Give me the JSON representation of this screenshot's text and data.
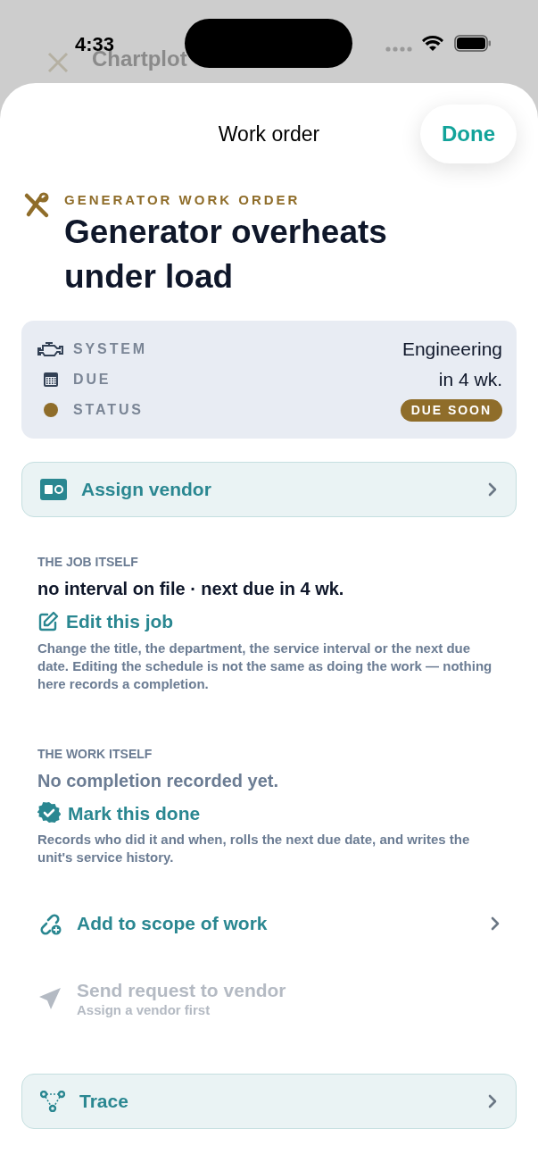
{
  "background": {
    "items": [
      {
        "title": "Chartplot"
      }
    ]
  },
  "status_bar": {
    "time": "4:33"
  },
  "header": {
    "title": "Work order",
    "done": "Done"
  },
  "order": {
    "eyebrow": "GENERATOR WORK ORDER",
    "title": "Generator overheats under load"
  },
  "details": [
    {
      "label": "SYSTEM",
      "value": "Engineering",
      "kind": "text"
    },
    {
      "label": "DUE",
      "value": "in 4 wk.",
      "kind": "text"
    },
    {
      "label": "STATUS",
      "value": "DUE SOON",
      "kind": "badge",
      "color": "#8f6d2a"
    }
  ],
  "assign": {
    "label": "Assign vendor"
  },
  "sections": [
    {
      "heading": "THE JOB ITSELF",
      "summary": "no interval on file · next due in 4 wk.",
      "summary_muted": false,
      "action": "Edit this job",
      "note": "Change the title, the department, the service interval or the next due date. Editing the schedule is not the same as doing the work — nothing here records a completion."
    },
    {
      "heading": "THE WORK ITSELF",
      "summary": "No completion recorded yet.",
      "summary_muted": true,
      "action": "Mark this done",
      "note": "Records who did it and when, rolls the next due date, and writes the unit's service history."
    }
  ],
  "actions": [
    {
      "label": "Add to scope of work",
      "disabled": false
    },
    {
      "label": "Send request to vendor",
      "subtitle": "Assign a vendor first",
      "disabled": true
    }
  ],
  "trace": {
    "label": "Trace"
  }
}
